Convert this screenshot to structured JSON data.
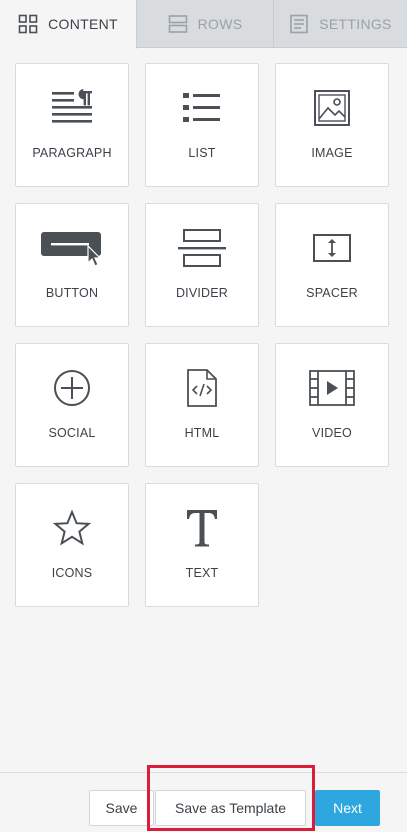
{
  "tabs": [
    {
      "label": "CONTENT",
      "icon": "grid-icon",
      "active": true
    },
    {
      "label": "ROWS",
      "icon": "rows-icon",
      "active": false
    },
    {
      "label": "SETTINGS",
      "icon": "settings-doc-icon",
      "active": false
    }
  ],
  "blocks": [
    {
      "label": "PARAGRAPH",
      "icon": "paragraph-icon"
    },
    {
      "label": "LIST",
      "icon": "list-icon"
    },
    {
      "label": "IMAGE",
      "icon": "image-icon"
    },
    {
      "label": "BUTTON",
      "icon": "button-icon"
    },
    {
      "label": "DIVIDER",
      "icon": "divider-icon"
    },
    {
      "label": "SPACER",
      "icon": "spacer-icon"
    },
    {
      "label": "SOCIAL",
      "icon": "social-plus-icon"
    },
    {
      "label": "HTML",
      "icon": "html-file-icon"
    },
    {
      "label": "VIDEO",
      "icon": "video-icon"
    },
    {
      "label": "ICONS",
      "icon": "star-icon"
    },
    {
      "label": "TEXT",
      "icon": "text-t-icon"
    }
  ],
  "footer": {
    "save_label": "Save",
    "save_template_label": "Save as Template",
    "next_label": "Next"
  },
  "colors": {
    "accent": "#2ea7e0",
    "highlight": "#d81e3a",
    "icon": "#4a5056"
  }
}
